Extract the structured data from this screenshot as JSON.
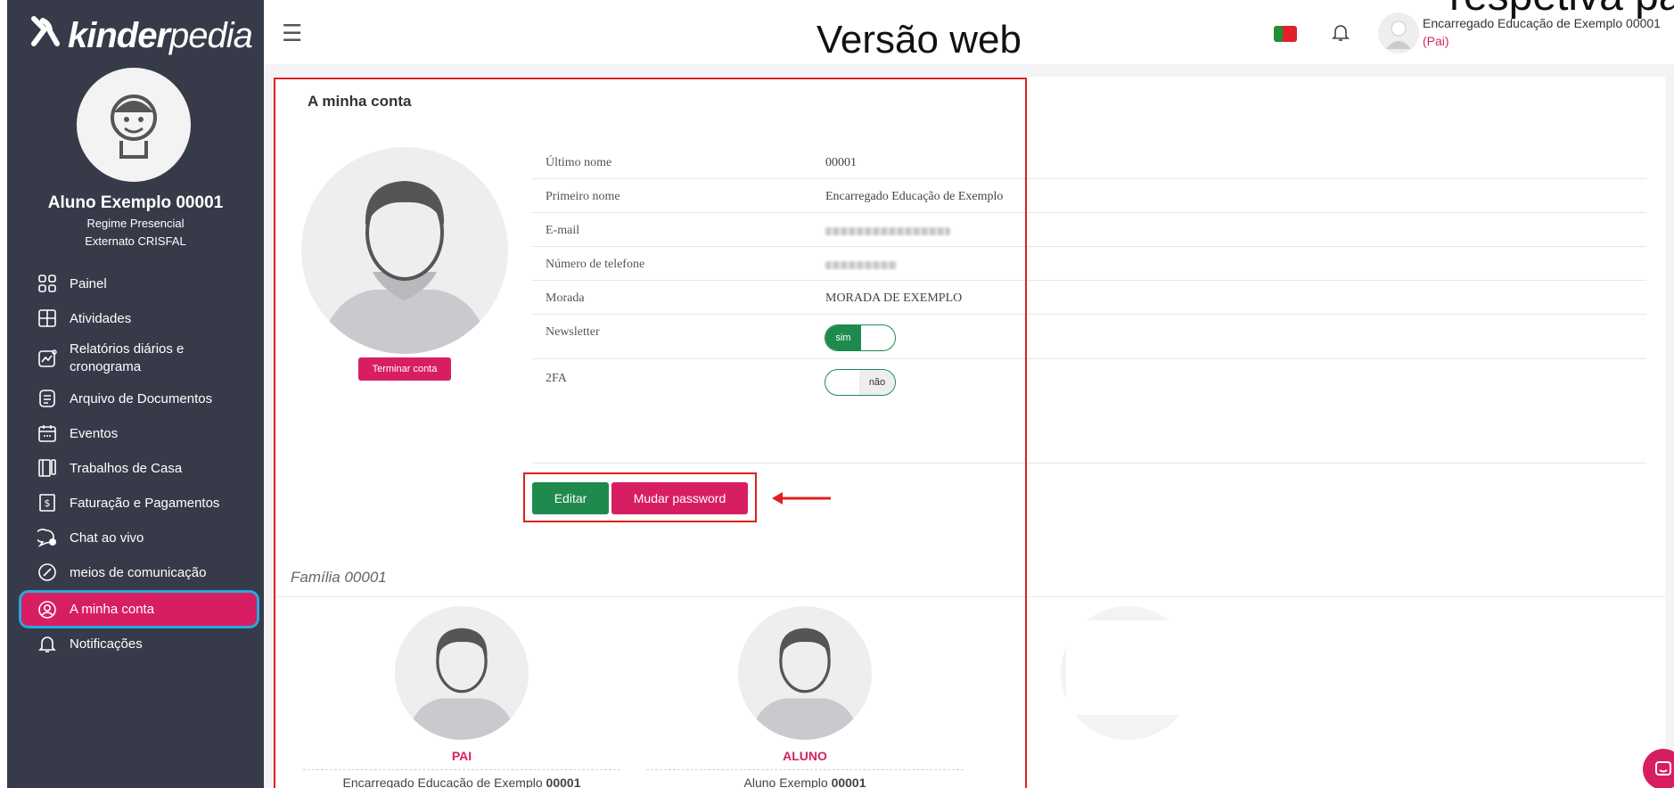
{
  "overlay": {
    "title": "respetiva password e",
    "version_label": "Versão web"
  },
  "sidebar": {
    "logo_mark": "Ƴ",
    "logo_bold": "kinder",
    "logo_light": "pedia",
    "student_name": "Aluno Exemplo 00001",
    "student_regime": "Regime Presencial",
    "student_school": "Externato CRISFAL",
    "items": [
      {
        "label": "Painel",
        "icon": "dashboard-icon"
      },
      {
        "label": "Atividades",
        "icon": "activities-icon"
      },
      {
        "label": "Relatórios diários e cronograma",
        "icon": "reports-icon"
      },
      {
        "label": "Arquivo de Documentos",
        "icon": "documents-icon"
      },
      {
        "label": "Eventos",
        "icon": "calendar-icon"
      },
      {
        "label": "Trabalhos de Casa",
        "icon": "homework-icon"
      },
      {
        "label": "Faturação e Pagamentos",
        "icon": "billing-icon"
      },
      {
        "label": "Chat ao vivo",
        "icon": "chat-icon"
      },
      {
        "label": "meios de comunicação",
        "icon": "media-icon"
      },
      {
        "label": "A minha conta",
        "icon": "account-icon"
      },
      {
        "label": "Notificações",
        "icon": "bell-icon"
      }
    ],
    "active_item": "A minha conta"
  },
  "header": {
    "user_name": "Encarregado Educação de Exemplo 00001",
    "user_role": "(Pai)",
    "language_flag": "pt"
  },
  "account": {
    "title": "A minha conta",
    "end_account_label": "Terminar conta",
    "fields": [
      {
        "label": "Último nome",
        "value": "00001"
      },
      {
        "label": "Primeiro nome",
        "value": "Encarregado Educação de Exemplo"
      },
      {
        "label": "E-mail",
        "value": ""
      },
      {
        "label": "Número de telefone",
        "value": ""
      },
      {
        "label": "Morada",
        "value": "MORADA DE EXEMPLO"
      },
      {
        "label": "Newsletter",
        "value": ""
      },
      {
        "label": "2FA",
        "value": ""
      }
    ],
    "newsletter_toggle": "sim",
    "twofa_toggle": "não",
    "edit_label": "Editar",
    "change_password_label": "Mudar password"
  },
  "family": {
    "title": "Família 00001",
    "members": [
      {
        "role": "PAI",
        "name_prefix": "Encarregado Educação de Exemplo",
        "name_number": "00001"
      },
      {
        "role": "ALUNO",
        "name_prefix": "Aluno Exemplo",
        "name_number": "00001"
      }
    ]
  },
  "colors": {
    "sidebar_bg": "#373b49",
    "accent": "#d81e63",
    "success": "#1f8a4d",
    "highlight_border": "#e02020",
    "active_outline": "#2aa7df"
  }
}
